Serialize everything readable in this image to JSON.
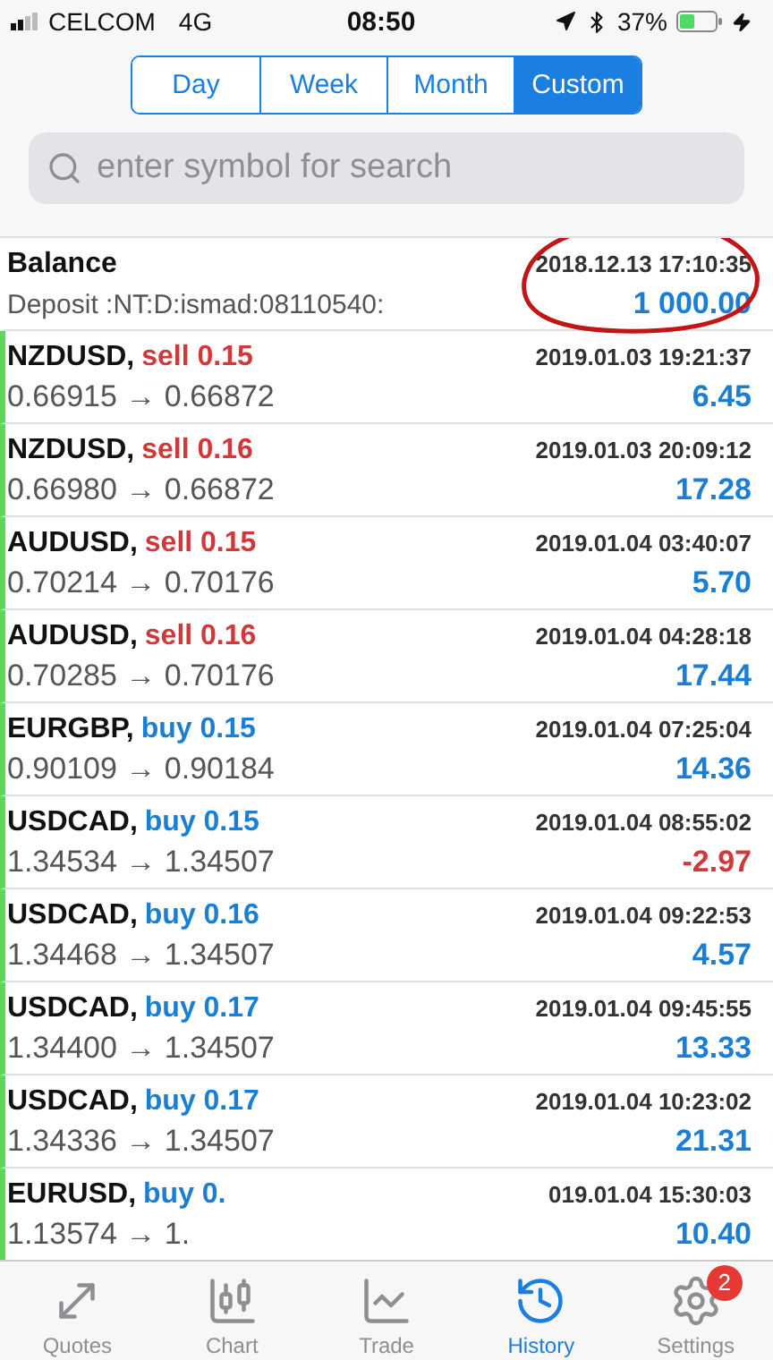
{
  "status_bar": {
    "carrier": "CELCOM",
    "network": "4G",
    "time": "08:50",
    "battery": "37%"
  },
  "periods": [
    {
      "label": "Day",
      "selected": false
    },
    {
      "label": "Week",
      "selected": false
    },
    {
      "label": "Month",
      "selected": false
    },
    {
      "label": "Custom",
      "selected": true
    }
  ],
  "search": {
    "placeholder": "enter symbol for search"
  },
  "rows": [
    {
      "kind": "balance",
      "title": "Balance",
      "comment": "Deposit :NT:D:ismad:08110540:",
      "time": "2018.12.13 17:10:35",
      "amount": "1 000.00"
    },
    {
      "kind": "sell",
      "symbol": "NZDUSD,",
      "order": "sell 0.15",
      "prices": "0.66915 → 0.66872",
      "time": "2019.01.03 19:21:37",
      "amount": "6.45",
      "loss": false
    },
    {
      "kind": "sell",
      "symbol": "NZDUSD,",
      "order": "sell 0.16",
      "prices": "0.66980 → 0.66872",
      "time": "2019.01.03 20:09:12",
      "amount": "17.28",
      "loss": false
    },
    {
      "kind": "sell",
      "symbol": "AUDUSD,",
      "order": "sell 0.15",
      "prices": "0.70214 → 0.70176",
      "time": "2019.01.04 03:40:07",
      "amount": "5.70",
      "loss": false
    },
    {
      "kind": "sell",
      "symbol": "AUDUSD,",
      "order": "sell 0.16",
      "prices": "0.70285 → 0.70176",
      "time": "2019.01.04 04:28:18",
      "amount": "17.44",
      "loss": false
    },
    {
      "kind": "buy",
      "symbol": "EURGBP,",
      "order": "buy 0.15",
      "prices": "0.90109 → 0.90184",
      "time": "2019.01.04 07:25:04",
      "amount": "14.36",
      "loss": false
    },
    {
      "kind": "buy",
      "symbol": "USDCAD,",
      "order": "buy 0.15",
      "prices": "1.34534 → 1.34507",
      "time": "2019.01.04 08:55:02",
      "amount": "-2.97",
      "loss": true
    },
    {
      "kind": "buy",
      "symbol": "USDCAD,",
      "order": "buy 0.16",
      "prices": "1.34468 → 1.34507",
      "time": "2019.01.04 09:22:53",
      "amount": "4.57",
      "loss": false
    },
    {
      "kind": "buy",
      "symbol": "USDCAD,",
      "order": "buy 0.17",
      "prices": "1.34400 → 1.34507",
      "time": "2019.01.04 09:45:55",
      "amount": "13.33",
      "loss": false
    },
    {
      "kind": "buy",
      "symbol": "USDCAD,",
      "order": "buy 0.17",
      "prices": "1.34336 → 1.34507",
      "time": "2019.01.04 10:23:02",
      "amount": "21.31",
      "loss": false
    },
    {
      "kind": "buy",
      "symbol": "EURUSD,",
      "order": "buy 0.",
      "prices": "1.13574 → 1.",
      "time": "019.01.04 15:30:03",
      "amount": "10.40",
      "loss": false
    }
  ],
  "tab_bar": [
    {
      "label": "Quotes",
      "selected": false
    },
    {
      "label": "Chart",
      "selected": false
    },
    {
      "label": "Trade",
      "selected": false
    },
    {
      "label": "History",
      "selected": true
    },
    {
      "label": "Settings",
      "selected": false,
      "badge": "2"
    }
  ]
}
